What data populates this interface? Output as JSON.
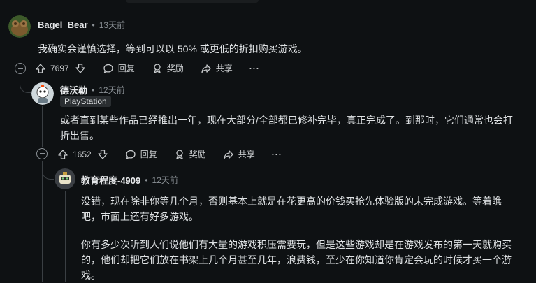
{
  "comments": [
    {
      "username": "Bagel_Bear",
      "time": "13天前",
      "paragraphs": [
        "我确实会谨慎选择，等到可以以 50% 或更低的折扣购买游戏。"
      ],
      "votes": "7697",
      "reply": "回复",
      "award": "奖励",
      "share": "共享",
      "more": "···"
    },
    {
      "username": "德沃勒",
      "time": "12天前",
      "flair": "PlayStation",
      "paragraphs": [
        "或者直到某些作品已经推出一年，现在大部分/全部都已修补完毕，真正完成了。到那时，它们通常也会打",
        "折出售。"
      ],
      "votes": "1652",
      "reply": "回复",
      "award": "奖励",
      "share": "共享",
      "more": "···"
    },
    {
      "username": "教育程度-4909",
      "time": "12天前",
      "paragraphs": [
        "没错，现在除非你等几个月，否则基本上就是在花更高的价钱买抢先体验版的未完成游戏。等着瞧",
        "吧，市面上还有好多游戏。",
        "你有多少次听到人们说他们有大量的游戏积压需要玩，但是这些游戏却是在游戏发布的第一天就购买",
        "的，他们却把它们放在书架上几个月甚至几年，浪费钱，至少在你知道你肯定会玩的时候才买一个游",
        "戏。"
      ]
    }
  ],
  "dot": "•",
  "colors": {
    "background": "#0e1113",
    "text": "#dfe2e4",
    "muted": "#8b9196"
  }
}
